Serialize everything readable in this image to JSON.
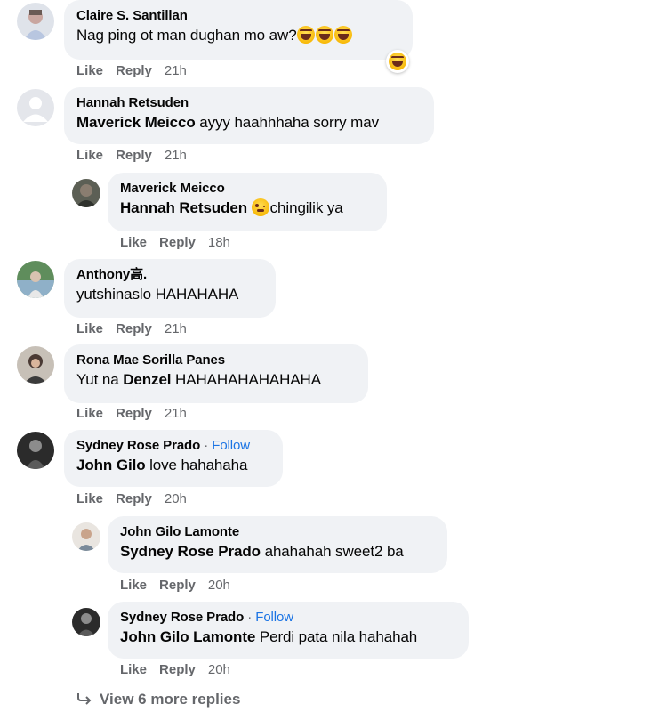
{
  "comments": [
    {
      "author": "Claire S. Santillan",
      "text": "Nag ping ot man dughan mo aw?",
      "emojis": [
        "laughing-emoji",
        "laughing-emoji",
        "laughing-emoji"
      ],
      "reaction": "laughing",
      "actions": {
        "like": "Like",
        "reply": "Reply",
        "time": "21h"
      }
    },
    {
      "author": "Hannah Retsuden",
      "mention": "Maverick Meicco",
      "text": " ayyy haahhhaha sorry mav",
      "actions": {
        "like": "Like",
        "reply": "Reply",
        "time": "21h"
      },
      "replies": [
        {
          "author": "Maverick Meicco",
          "mention": "Hannah Retsuden",
          "emoji": "winking-emoji",
          "text": "chingilik ya",
          "actions": {
            "like": "Like",
            "reply": "Reply",
            "time": "18h"
          }
        }
      ]
    },
    {
      "author": "Anthony高.",
      "text": "yutshinaslo HAHAHAHA",
      "actions": {
        "like": "Like",
        "reply": "Reply",
        "time": "21h"
      }
    },
    {
      "author": "Rona Mae Sorilla Panes",
      "text_before": "Yut na ",
      "mention": "Denzel",
      "text": " HAHAHAHAHAHAHA",
      "actions": {
        "like": "Like",
        "reply": "Reply",
        "time": "21h"
      }
    },
    {
      "author": "Sydney Rose Prado",
      "separator": "·",
      "follow": "Follow",
      "mention": "John Gilo",
      "text": " love hahahaha",
      "actions": {
        "like": "Like",
        "reply": "Reply",
        "time": "20h"
      },
      "replies": [
        {
          "author": "John Gilo Lamonte",
          "mention": "Sydney Rose Prado",
          "text": " ahahahah sweet2 ba",
          "actions": {
            "like": "Like",
            "reply": "Reply",
            "time": "20h"
          }
        },
        {
          "author": "Sydney Rose Prado",
          "separator": "·",
          "follow": "Follow",
          "mention": "John Gilo Lamonte",
          "text": " Perdi pata nila hahahah",
          "actions": {
            "like": "Like",
            "reply": "Reply",
            "time": "20h"
          }
        }
      ]
    }
  ],
  "view_more": "View 6 more replies",
  "colors": {
    "bubble": "#f0f2f5",
    "meta": "#65676b",
    "follow": "#1b74e4"
  }
}
